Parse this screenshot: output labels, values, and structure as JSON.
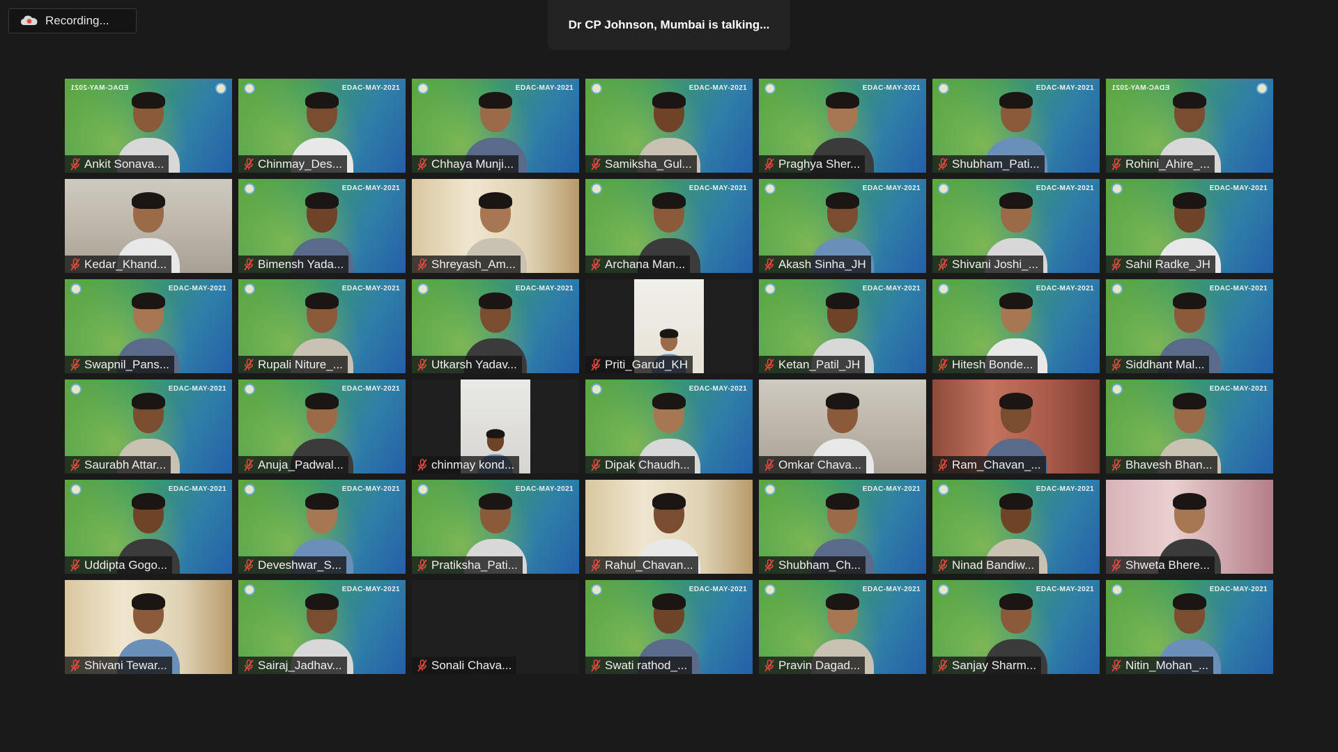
{
  "recording": {
    "label": "Recording...",
    "icon": "cloud-recording-icon"
  },
  "talking": {
    "text": "Dr CP Johnson, Mumbai is talking..."
  },
  "colors": {
    "mic_muted": "#e04a3f",
    "background": "#1a1a1a"
  },
  "watermark_text": "EDAC-MAY-2021",
  "participants": [
    {
      "name": "Ankit Sonava...",
      "bg": "green",
      "mirror": true
    },
    {
      "name": "Chinmay_Des...",
      "bg": "green"
    },
    {
      "name": "Chhaya Munji...",
      "bg": "green"
    },
    {
      "name": "Samiksha_Gul...",
      "bg": "green"
    },
    {
      "name": "Praghya Sher...",
      "bg": "green"
    },
    {
      "name": "Shubham_Pati...",
      "bg": "green"
    },
    {
      "name": "Rohini_Ahire_...",
      "bg": "green",
      "mirror": true
    },
    {
      "name": "Kedar_Khand...",
      "bg": "room"
    },
    {
      "name": "Bimensh Yada...",
      "bg": "green"
    },
    {
      "name": "Shreyash_Am...",
      "bg": "curtain"
    },
    {
      "name": "Archana Man...",
      "bg": "green"
    },
    {
      "name": "Akash Sinha_JH",
      "bg": "green"
    },
    {
      "name": "Shivani Joshi_...",
      "bg": "green"
    },
    {
      "name": "Sahil Radke_JH",
      "bg": "green"
    },
    {
      "name": "Swapnil_Pans...",
      "bg": "green"
    },
    {
      "name": "Rupali Niture_...",
      "bg": "green"
    },
    {
      "name": "Utkarsh Yadav...",
      "bg": "green"
    },
    {
      "name": "Priti_Garud_KH",
      "bg": "dark-video",
      "variant": "priti"
    },
    {
      "name": "Ketan_Patil_JH",
      "bg": "green"
    },
    {
      "name": "Hitesh Bonde...",
      "bg": "green"
    },
    {
      "name": "Siddhant Mal...",
      "bg": "green"
    },
    {
      "name": "Saurabh Attar...",
      "bg": "green"
    },
    {
      "name": "Anuja_Padwal...",
      "bg": "green"
    },
    {
      "name": "chinmay kond...",
      "bg": "dark-video"
    },
    {
      "name": "Dipak Chaudh...",
      "bg": "green"
    },
    {
      "name": "Omkar Chava...",
      "bg": "room"
    },
    {
      "name": "Ram_Chavan_...",
      "bg": "brick"
    },
    {
      "name": "Bhavesh Bhan...",
      "bg": "green"
    },
    {
      "name": "Uddipta Gogo...",
      "bg": "green"
    },
    {
      "name": "Deveshwar_S...",
      "bg": "green"
    },
    {
      "name": "Pratiksha_Pati...",
      "bg": "green"
    },
    {
      "name": "Rahul_Chavan...",
      "bg": "curtain"
    },
    {
      "name": "Shubham_Ch...",
      "bg": "green"
    },
    {
      "name": "Ninad Bandiw...",
      "bg": "green"
    },
    {
      "name": "Shweta Bhere...",
      "bg": "pink"
    },
    {
      "name": "Shivani Tewar...",
      "bg": "curtain"
    },
    {
      "name": "Sairaj_Jadhav...",
      "bg": "green"
    },
    {
      "name": "Sonali Chava...",
      "bg": "dark-empty"
    },
    {
      "name": "Swati rathod_...",
      "bg": "green"
    },
    {
      "name": "Pravin Dagad...",
      "bg": "green"
    },
    {
      "name": "Sanjay Sharm...",
      "bg": "green"
    },
    {
      "name": "Nitin_Mohan_...",
      "bg": "green"
    }
  ]
}
